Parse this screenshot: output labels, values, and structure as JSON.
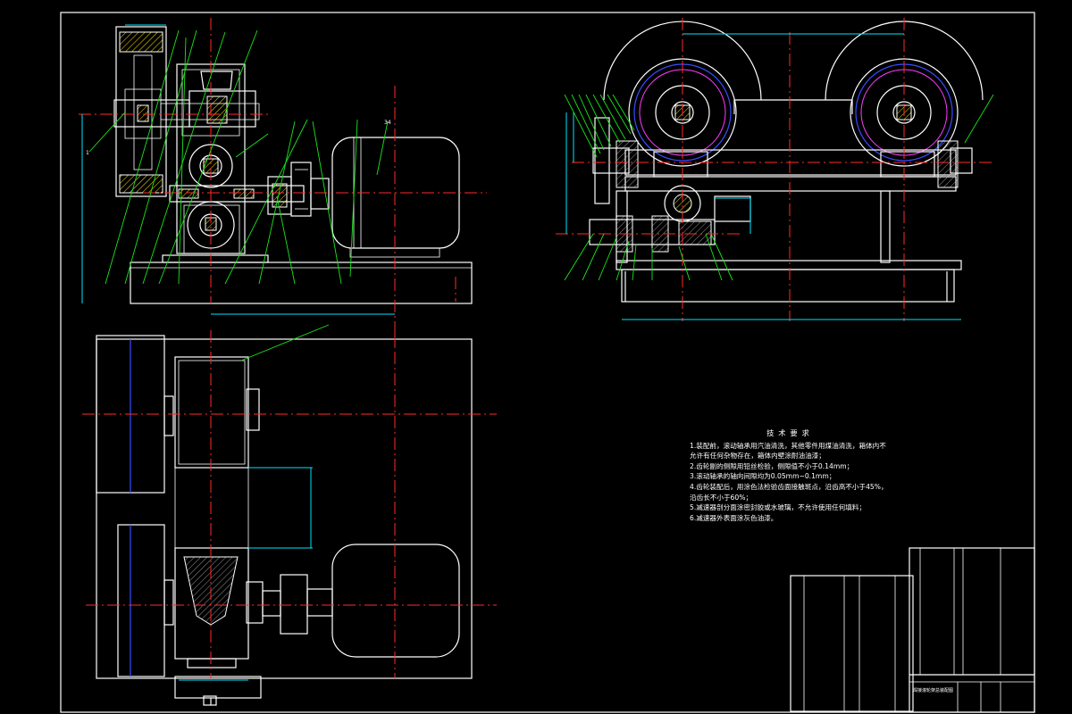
{
  "technical_notes": {
    "title": "技术要求",
    "lines": [
      "1.装配前，滚动轴承用汽油清洗，其他零件用煤油清洗，箱体内不允许有任何杂物存在，箱体内壁涂耐油油漆；",
      "2.齿轮副的侧隙用铅丝检验，侧隙值不小于0.14mm；",
      "3.滚动轴承的轴向间隙均为0.05mm~0.1mm；",
      "4.齿轮装配后，用涂色法检验齿面接触斑点，沿齿高不小于45%，沿齿长不小于60%；",
      "5.减速器剖分面涂密封胶或水玻璃，不允许使用任何填料；",
      "6.减速器外表面涂灰色油漆。"
    ]
  },
  "labels": {
    "motor_number": "34",
    "wheel_number": "1",
    "drawing_title": "焊接滚轮架总装配图"
  },
  "colors": {
    "background": "#000000",
    "outline": "#ffffff",
    "centerline": "#ff2a2a",
    "leader": "#19e619",
    "dimension": "#00e5ff",
    "hatch": "#ffe600",
    "rubber_ring": "#3a4dff"
  }
}
